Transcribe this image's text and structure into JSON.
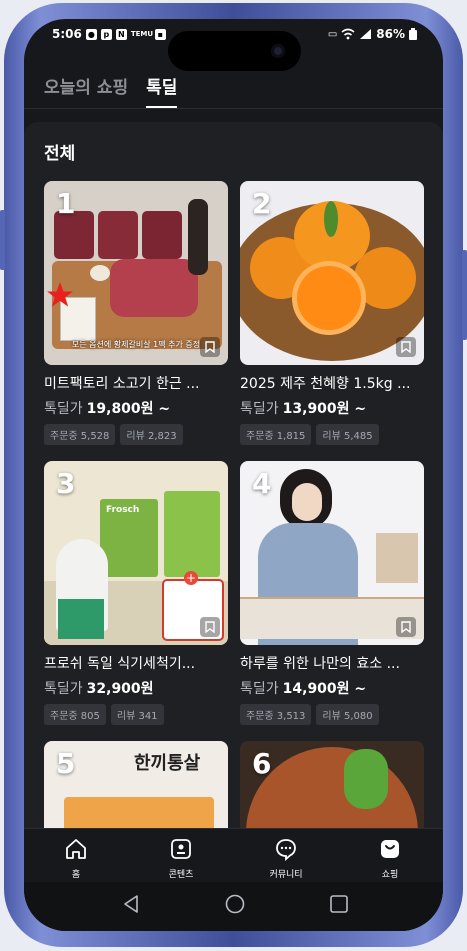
{
  "status_bar": {
    "time": "5:06",
    "battery": "86%",
    "badge_m": "N",
    "badge_temu": "TEMU"
  },
  "tabs": [
    {
      "label": "오늘의 쇼핑"
    },
    {
      "label": "톡딜"
    }
  ],
  "section_title": "전체",
  "products": [
    {
      "rank": "1",
      "title": "미트팩토리 소고기 한근 ...",
      "price_label": "톡딜가",
      "price": "19,800원 ~",
      "orders": "주문중 5,528",
      "reviews": "리뷰 2,823",
      "image_caption": "모든 옵션에 황제갈비살 1팩 추가 증정"
    },
    {
      "rank": "2",
      "title": "2025 제주 천혜향 1.5kg ...",
      "price_label": "톡딜가",
      "price": "13,900원 ~",
      "orders": "주문중 1,815",
      "reviews": "리뷰 5,485"
    },
    {
      "rank": "3",
      "title": "프로쉬 독일 식기세척기...",
      "price_label": "톡딜가",
      "price": "32,900원",
      "orders": "주문중 805",
      "reviews": "리뷰 341",
      "image_caption": "Frosch"
    },
    {
      "rank": "4",
      "title": "하루를 위한 나만의 효소 ...",
      "price_label": "톡딜가",
      "price": "14,900원 ~",
      "orders": "주문중 3,513",
      "reviews": "리뷰 5,080"
    },
    {
      "rank": "5",
      "image_caption": "한끼통살"
    },
    {
      "rank": "6"
    }
  ],
  "bottom_nav": [
    {
      "label": "홈"
    },
    {
      "label": "콘텐츠"
    },
    {
      "label": "커뮤니티"
    },
    {
      "label": "쇼핑"
    }
  ],
  "colors": {
    "background": "#17181c",
    "panel": "#1f2024",
    "frame": "#5b6bc0",
    "chip": "#33353b"
  }
}
